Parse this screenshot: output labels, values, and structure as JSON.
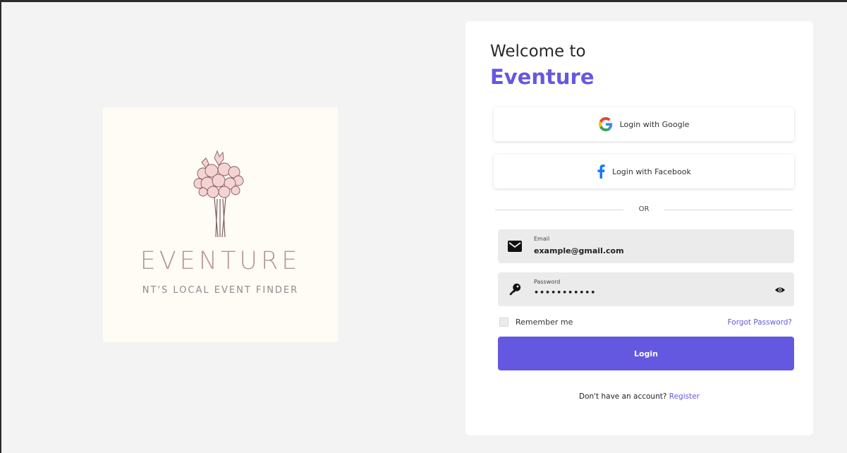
{
  "logo": {
    "title": "EVENTURE",
    "subtitle": "NT'S LOCAL EVENT FINDER"
  },
  "login_card": {
    "welcome": "Welcome to",
    "brand": "Eventure",
    "google_label": "Login with Google",
    "facebook_label": "Login with Facebook",
    "or_text": "OR",
    "email_label": "Email",
    "email_value": "example@gmail.com",
    "password_label": "Password",
    "password_value": "•••••••••••",
    "remember_label": "Remember me",
    "forgot_label": "Forgot Password?",
    "login_label": "Login",
    "no_account_text": "Don't have an account?",
    "register_label": "Register"
  },
  "icons": {
    "google": "google-icon",
    "facebook": "facebook-icon",
    "email": "mail-icon",
    "password": "key-icon",
    "toggle_visibility": "eye-icon"
  },
  "colors": {
    "accent": "#6558e0",
    "background": "#f3f3f3",
    "logo_background": "#fffbf5",
    "field_background": "#ebebeb"
  }
}
